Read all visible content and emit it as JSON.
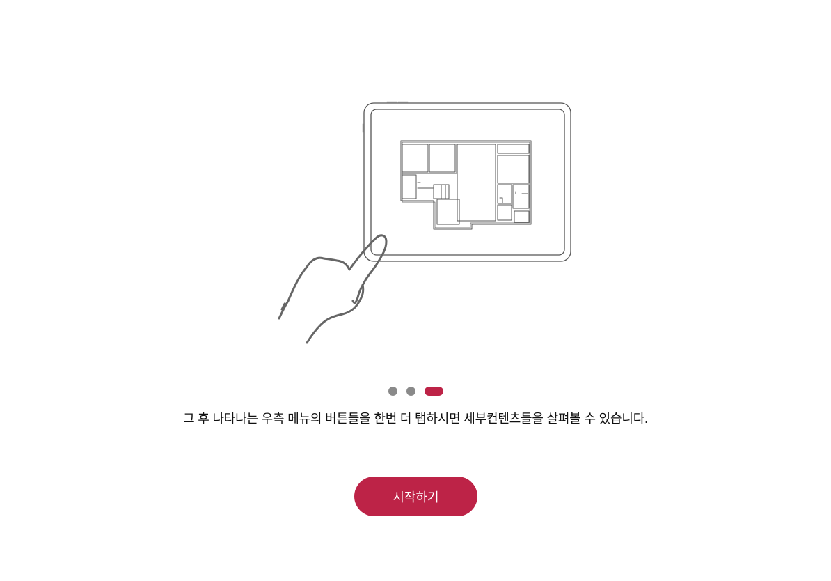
{
  "colors": {
    "accent": "#bd2347",
    "dot_inactive": "#8a8a8a",
    "line_art": "#555555",
    "text": "#111111",
    "button_text": "#ffffff"
  },
  "illustration": {
    "device_icon": "tablet-icon",
    "content_icon": "floor-plan-icon",
    "gesture_icon": "hand-tap-icon"
  },
  "pager": {
    "total": 3,
    "current_index": 2
  },
  "caption": "그 후 나타나는 우측 메뉴의 버튼들을 한번 더 탭하시면 세부컨텐츠들을 살펴볼 수 있습니다.",
  "start_button": {
    "label": "시작하기"
  }
}
